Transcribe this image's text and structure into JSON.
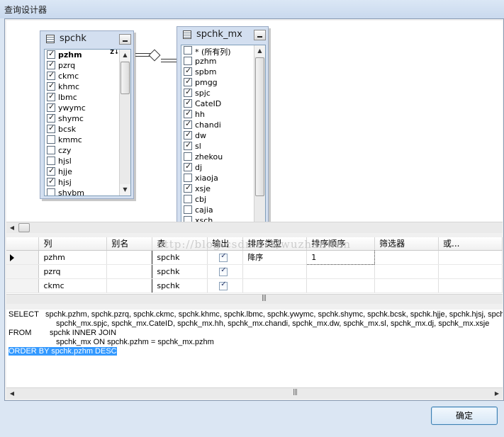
{
  "window": {
    "title": "查询设计器"
  },
  "tables": [
    {
      "name": "spchk",
      "columns": [
        {
          "label": "pzhm",
          "checked": true,
          "selected": true
        },
        {
          "label": "pzrq",
          "checked": true
        },
        {
          "label": "ckmc",
          "checked": true
        },
        {
          "label": "khmc",
          "checked": true
        },
        {
          "label": "lbmc",
          "checked": true
        },
        {
          "label": "ywymc",
          "checked": true
        },
        {
          "label": "shymc",
          "checked": true
        },
        {
          "label": "bcsk",
          "checked": true
        },
        {
          "label": "kmmc",
          "checked": false
        },
        {
          "label": "czy",
          "checked": false
        },
        {
          "label": "hjsl",
          "checked": false
        },
        {
          "label": "hjje",
          "checked": true
        },
        {
          "label": "hjsj",
          "checked": true
        },
        {
          "label": "shybm",
          "checked": false
        }
      ],
      "sort_indicator": "Z↓A"
    },
    {
      "name": "spchk_mx",
      "columns": [
        {
          "label": "* (所有列)",
          "checked": false
        },
        {
          "label": "pzhm",
          "checked": false
        },
        {
          "label": "spbm",
          "checked": true
        },
        {
          "label": "pmgg",
          "checked": true
        },
        {
          "label": "spjc",
          "checked": true
        },
        {
          "label": "CateID",
          "checked": true
        },
        {
          "label": "hh",
          "checked": true
        },
        {
          "label": "chandi",
          "checked": true
        },
        {
          "label": "dw",
          "checked": true
        },
        {
          "label": "sl",
          "checked": true
        },
        {
          "label": "zhekou",
          "checked": false
        },
        {
          "label": "dj",
          "checked": true
        },
        {
          "label": "xiaoja",
          "checked": false
        },
        {
          "label": "xsje",
          "checked": true
        },
        {
          "label": "cbj",
          "checked": false
        },
        {
          "label": "cajia",
          "checked": false
        },
        {
          "label": "xsch",
          "checked": false
        }
      ]
    }
  ],
  "grid": {
    "headers": [
      "列",
      "别名",
      "表",
      "输出",
      "排序类型",
      "排序顺序",
      "筛选器",
      "或..."
    ],
    "rows": [
      {
        "column": "pzhm",
        "alias": "",
        "table": "spchk",
        "output": true,
        "sort_type": "降序",
        "sort_order": "1",
        "filter": "",
        "or": ""
      },
      {
        "column": "pzrq",
        "alias": "",
        "table": "spchk",
        "output": true,
        "sort_type": "",
        "sort_order": "",
        "filter": "",
        "or": ""
      },
      {
        "column": "ckmc",
        "alias": "",
        "table": "spchk",
        "output": true,
        "sort_type": "",
        "sort_order": "",
        "filter": "",
        "or": ""
      }
    ]
  },
  "sql": {
    "select_kw": "SELECT",
    "select_line1": "spchk.pzhm, spchk.pzrq, spchk.ckmc, spchk.khmc, spchk.lbmc, spchk.ywymc, spchk.shymc, spchk.bcsk, spchk.hjje, spchk.hjsj, spchk_mx.spbm, spchk_mx.pmgg,",
    "select_line2": "spchk_mx.spjc, spchk_mx.CateID, spchk_mx.hh, spchk_mx.chandi, spchk_mx.dw, spchk_mx.sl, spchk_mx.dj, spchk_mx.xsje",
    "from_kw": "FROM",
    "from_line1": "spchk INNER JOIN",
    "from_line2": "spchk_mx ON spchk.pzhm = spchk_mx.pzhm",
    "order_line": "ORDER BY spchk.pzhm DESC"
  },
  "watermark": "http://blog.csdn.net/wuzhanwen",
  "ok_button": "确定",
  "icons": [
    "table-icon",
    "minimize-icon",
    "sort-descending-icon",
    "join-diamond-icon",
    "row-pointer-icon",
    "scroll-arrow-icon"
  ]
}
